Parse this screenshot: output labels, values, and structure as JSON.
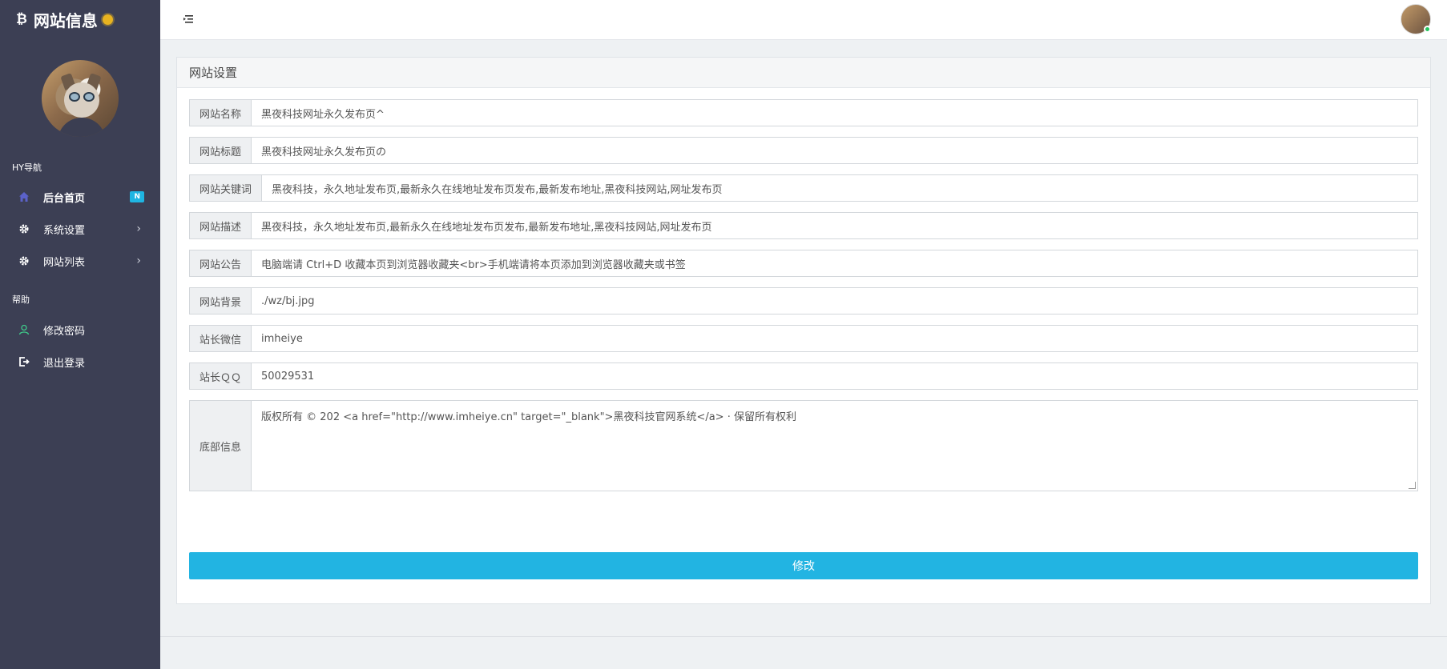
{
  "brand": {
    "title": "网站信息",
    "icon": "bitcoin-icon"
  },
  "sidebar": {
    "section_nav": "HY导航",
    "section_help": "帮助",
    "nav": [
      {
        "label": "后台首页",
        "icon": "home-icon",
        "badge": "N",
        "active": true
      },
      {
        "label": "系统设置",
        "icon": "gear-icon"
      },
      {
        "label": "网站列表",
        "icon": "gear-icon"
      }
    ],
    "help": [
      {
        "label": "修改密码",
        "icon": "user-icon"
      },
      {
        "label": "退出登录",
        "icon": "logout-icon"
      }
    ]
  },
  "panel": {
    "title": "网站设置",
    "fields": [
      {
        "label": "网站名称",
        "value": "黑夜科技网址永久发布页^"
      },
      {
        "label": "网站标题",
        "value": "黑夜科技网址永久发布页の"
      },
      {
        "label": "网站关键词",
        "value": "黑夜科技，永久地址发布页,最新永久在线地址发布页发布,最新发布地址,黑夜科技网站,网址发布页"
      },
      {
        "label": "网站描述",
        "value": "黑夜科技，永久地址发布页,最新永久在线地址发布页发布,最新发布地址,黑夜科技网站,网址发布页"
      },
      {
        "label": "网站公告",
        "value": "电脑端请 Ctrl+D 收藏本页到浏览器收藏夹<br>手机端请将本页添加到浏览器收藏夹或书签"
      },
      {
        "label": "网站背景",
        "value": "./wz/bj.jpg"
      },
      {
        "label": "站长微信",
        "value": "imheiye"
      },
      {
        "label": "站长ＱＱ",
        "value": "50029531"
      }
    ],
    "footer_field": {
      "label": "底部信息",
      "value": "版权所有 © 202 <a href=\"http://www.imheiye.cn\" target=\"_blank\">黑夜科技官网系统</a> · 保留所有权利"
    },
    "submit_label": "修改"
  },
  "colors": {
    "sidebar_bg": "#3c3f54",
    "accent": "#22b4e2",
    "online": "#23c45e"
  }
}
